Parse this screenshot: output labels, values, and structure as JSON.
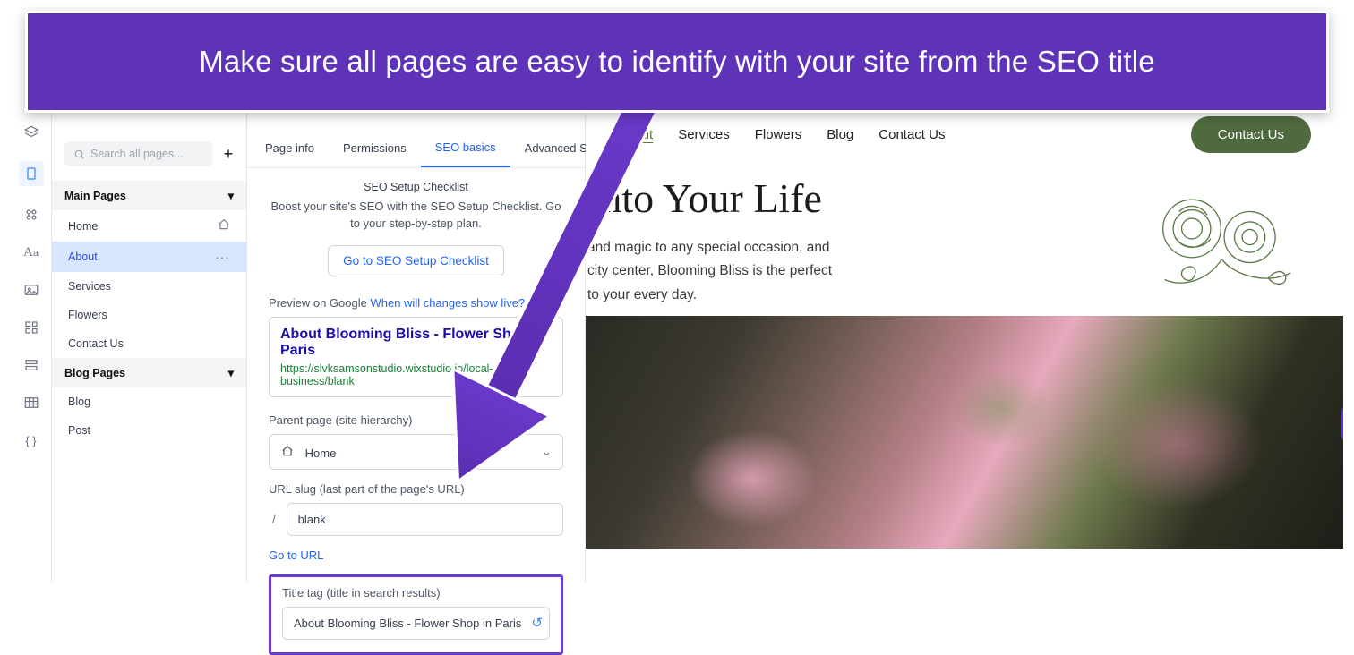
{
  "banner": {
    "text": "Make sure all pages are easy to identify with your site from the SEO title"
  },
  "rail": {
    "icons": [
      "layers",
      "pages",
      "db",
      "text",
      "image",
      "grid",
      "section",
      "table",
      "code"
    ],
    "active": "pages"
  },
  "sidebar": {
    "search_placeholder": "Search all pages...",
    "sections": [
      {
        "title": "Main Pages",
        "items": [
          {
            "label": "Home",
            "home": true
          },
          {
            "label": "About",
            "active": true
          },
          {
            "label": "Services"
          },
          {
            "label": "Flowers"
          },
          {
            "label": "Contact Us"
          }
        ]
      },
      {
        "title": "Blog Pages",
        "items": [
          {
            "label": "Blog"
          },
          {
            "label": "Post"
          }
        ]
      }
    ]
  },
  "settings": {
    "tabs": [
      "Page info",
      "Permissions",
      "SEO basics",
      "Advanced SEO"
    ],
    "active_tab": 2,
    "checklist_header": "SEO Setup Checklist",
    "checklist_blurb": "Boost your site's SEO with the SEO Setup Checklist. Go to your step-by-step plan.",
    "checklist_button": "Go to SEO Setup Checklist",
    "preview_label": "Preview on Google",
    "preview_changes_link": "When will changes show live?",
    "preview_title": "About Blooming Bliss - Flower Shop in Paris",
    "preview_url": "https://slvksamsonstudio.wixstudio.io/local-business/blank",
    "parent_label": "Parent page (site hierarchy)",
    "parent_value": "Home",
    "slug_label": "URL slug (last part of the page's URL)",
    "slug_value": "blank",
    "go_to_url": "Go to URL",
    "title_tag_label": "Title tag (title in search results)",
    "title_tag_value": "About Blooming Bliss - Flower Shop in Paris"
  },
  "site": {
    "nav": [
      "About",
      "Services",
      "Flowers",
      "Blog",
      "Contact Us"
    ],
    "nav_active": 0,
    "cta": "Contact Us",
    "hero_title": "Into Your Life",
    "hero_body_1": "and magic to any special occasion, and",
    "hero_body_2": "city center, Blooming Bliss is the perfect",
    "hero_body_3": "to your every day."
  }
}
